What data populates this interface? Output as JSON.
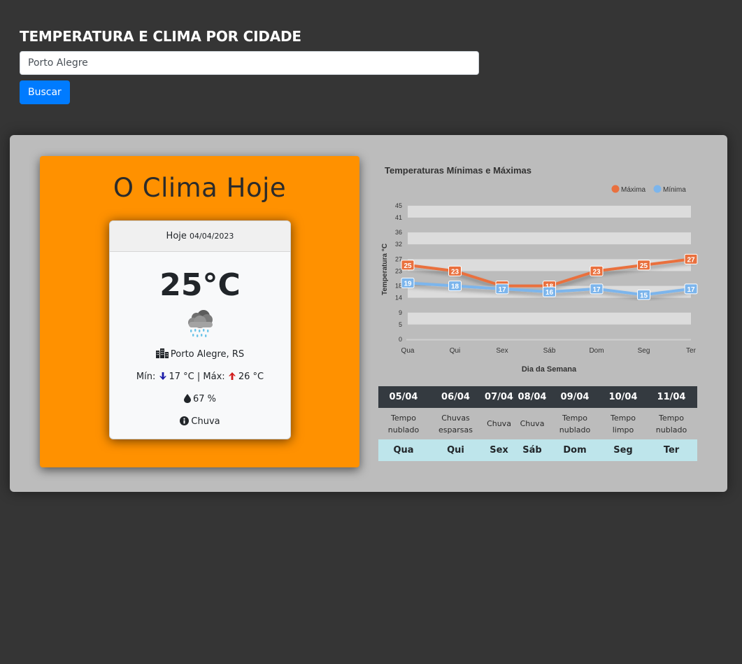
{
  "header": {
    "title": "TEMPERATURA E CLIMA POR CIDADE",
    "search_value": "Porto Alegre",
    "search_button": "Buscar"
  },
  "today": {
    "heading": "O Clima Hoje",
    "label": "Hoje",
    "date": "04/04/2023",
    "temperature": "25°C",
    "weather_icon": "rain-cloud-icon",
    "location": "Porto Alegre, RS",
    "min_label": "Mín:",
    "min_value": "17 °C |",
    "max_label": "Máx:",
    "max_value": "26 °C",
    "humidity": "67 %",
    "description": "Chuva"
  },
  "chart_data": {
    "type": "line",
    "title": "Temperaturas Mínimas e Máximas",
    "xlabel": "Dia da Semana",
    "ylabel": "Temperatura °C",
    "categories": [
      "Qua",
      "Qui",
      "Sex",
      "Sáb",
      "Dom",
      "Seg",
      "Ter"
    ],
    "yticks": [
      0,
      5,
      9,
      14,
      18,
      23,
      27,
      32,
      36,
      41,
      45
    ],
    "ylim": [
      0,
      45
    ],
    "legend_position": "top-right",
    "series": [
      {
        "name": "Máxima",
        "values": [
          25,
          23,
          18,
          18,
          23,
          25,
          27
        ],
        "color": "#e9703e"
      },
      {
        "name": "Mínima",
        "values": [
          19,
          18,
          17,
          16,
          17,
          15,
          17
        ],
        "color": "#7cb5ec"
      }
    ]
  },
  "forecast": {
    "days": [
      {
        "date": "05/04",
        "description": "Tempo nublado",
        "weekday": "Qua"
      },
      {
        "date": "06/04",
        "description": "Chuvas esparsas",
        "weekday": "Qui"
      },
      {
        "date": "07/04",
        "description": "Chuva",
        "weekday": "Sex"
      },
      {
        "date": "08/04",
        "description": "Chuva",
        "weekday": "Sáb"
      },
      {
        "date": "09/04",
        "description": "Tempo nublado",
        "weekday": "Dom"
      },
      {
        "date": "10/04",
        "description": "Tempo limpo",
        "weekday": "Seg"
      },
      {
        "date": "11/04",
        "description": "Tempo nublado",
        "weekday": "Ter"
      }
    ]
  }
}
